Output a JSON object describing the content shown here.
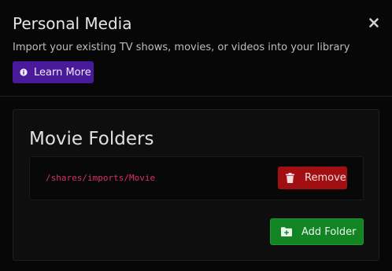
{
  "dialog": {
    "title": "Personal Media",
    "subtitle": "Import your existing TV shows, movies, or videos into your library",
    "close_icon": "close-icon",
    "learn_more_label": "Learn More",
    "learn_more_icon": "info-circle-icon"
  },
  "folders_section": {
    "title": "Movie Folders",
    "folders": [
      {
        "path": "/shares/imports/Movie",
        "remove_label": "Remove",
        "remove_icon": "trash-icon"
      }
    ],
    "add_folder_label": "Add Folder",
    "add_folder_icon": "folder-plus-icon"
  },
  "colors": {
    "background": "#070707",
    "learn_more_button": "#4b1a9a",
    "remove_button": "#a10f13",
    "add_folder_button": "#128424",
    "path_text": "#d6316b"
  }
}
